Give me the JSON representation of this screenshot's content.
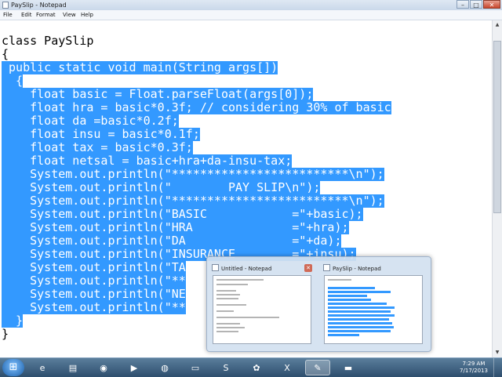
{
  "window": {
    "title": "PaySlip - Notepad"
  },
  "window_controls": {
    "minimize": "–",
    "maximize": "□",
    "close": "✕"
  },
  "menu": [
    "File",
    "Edit",
    "Format",
    "View",
    "Help"
  ],
  "code_lines": [
    "class PaySlip",
    "{",
    " public static void main(String args[])",
    "  {",
    "    float basic = Float.parseFloat(args[0]);",
    "    float hra = basic*0.3f; // considering 30% of basic",
    "    float da =basic*0.2f;",
    "    float insu = basic*0.1f;",
    "    float tax = basic*0.3f;",
    "    float netsal = basic+hra+da-insu-tax;",
    "    System.out.println(\"*************************\\n\");",
    "    System.out.println(\"        PAY SLIP\\n\");",
    "    System.out.println(\"*************************\\n\");",
    "    System.out.println(\"BASIC            =\"+basic);",
    "    System.out.println(\"HRA              =\"+hra);",
    "    System.out.println(\"DA               =\"+da);",
    "    System.out.println(\"INSURANCE        =\"+insu);",
    "    System.out.println(\"TA",
    "    System.out.println(\"**",
    "    System.out.println(\"NE",
    "    System.out.println(\"**",
    "  }",
    "}"
  ],
  "taskbar_previews": [
    {
      "title": "Untitled - Notepad",
      "close": "✕"
    },
    {
      "title": "PaySlip - Notepad"
    }
  ],
  "taskbar": {
    "start": "⊞",
    "apps": [
      {
        "name": "internet-explorer-icon",
        "glyph": "e"
      },
      {
        "name": "folder-icon",
        "glyph": "▤"
      },
      {
        "name": "chrome-icon",
        "glyph": "◉"
      },
      {
        "name": "media-player-icon",
        "glyph": "▶"
      },
      {
        "name": "firefox-icon",
        "glyph": "◍"
      },
      {
        "name": "sticky-notes-icon",
        "glyph": "▭"
      },
      {
        "name": "skype-icon",
        "glyph": "S"
      },
      {
        "name": "gear-icon",
        "glyph": "✿"
      },
      {
        "name": "excel-icon",
        "glyph": "X"
      },
      {
        "name": "notepad-icon",
        "glyph": "✎"
      },
      {
        "name": "command-prompt-icon",
        "glyph": "▬"
      }
    ],
    "clock_time": "7:29 AM",
    "clock_date": "7/17/2013"
  },
  "colors": {
    "selection": "#3399ff",
    "taskbar": "#2e4e6d"
  }
}
